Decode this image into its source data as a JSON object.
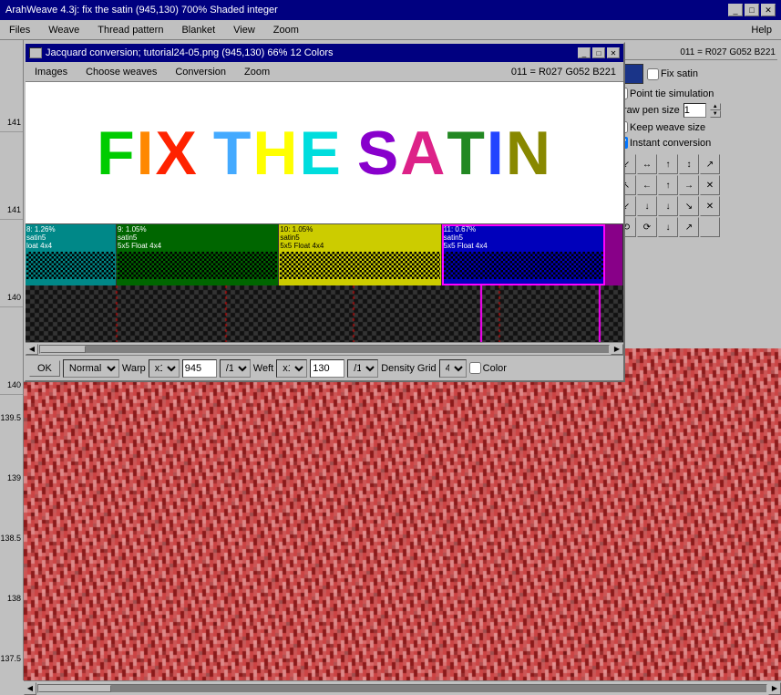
{
  "titleBar": {
    "title": "ArahWeave 4.3j: fix the satin (945,130) 700% Shaded integer",
    "controls": [
      "minimize",
      "maximize",
      "close"
    ]
  },
  "menuBar": {
    "items": [
      "Files",
      "Weave",
      "Thread pattern",
      "Blanket",
      "View",
      "Zoom",
      "Help"
    ]
  },
  "subWindow": {
    "title": "Jacquard conversion; tutorial24-05.png (945,130) 66% 12 Colors",
    "menu": {
      "left": [
        "Images",
        "Choose weaves",
        "Conversion",
        "Zoom"
      ],
      "right": "011 = R027 G052 B221"
    },
    "rightPanel": {
      "fixSatin": "Fix satin",
      "pointTie": "Point tie simulation",
      "drawPenSize": "Draw pen size",
      "penSizeValue": "1",
      "keepWeaveSize": "Keep weave size",
      "instantConversion": "Instant conversion"
    },
    "weaveStrips": [
      {
        "id": "8",
        "percent": "8: 1.26%",
        "weave": "satin5",
        "float": "loat 4x4",
        "color": "cyan"
      },
      {
        "id": "9",
        "percent": "9: 1.05%",
        "weave": "satin5",
        "float": "5x5 Float 4x4",
        "color": "green"
      },
      {
        "id": "10",
        "percent": "10: 1.05%",
        "weave": "satin5",
        "float": "5x5 Float 4x4",
        "color": "yellow"
      },
      {
        "id": "11",
        "percent": "11: 0.67%",
        "weave": "satin5",
        "float": "5x5 Float 4x4",
        "color": "blue"
      }
    ],
    "toolbar": {
      "ok": "OK",
      "mode": "Normal",
      "warp": "Warp",
      "warpMultiplier": "x1",
      "warpValue": "945",
      "warpDivider": "/1",
      "weft": "Weft",
      "weftMultiplier": "x1",
      "weftValue": "130",
      "weftDivider": "/1",
      "density": "Density",
      "grid": "Grid",
      "gridValue": "4",
      "color": "Color"
    }
  },
  "rulerLabels": [
    "141",
    "141",
    "140",
    "140"
  ],
  "sideRulerLabels": [
    "139.5",
    "139",
    "138.5",
    "138",
    "137.5"
  ],
  "arrowButtons": {
    "row1": [
      "↙",
      "↔",
      "↑",
      "↕",
      "↗"
    ],
    "row2": [
      "↖",
      "←",
      "↑",
      "→",
      "✕"
    ],
    "row3": [
      "↙",
      "↓",
      "↓",
      "↘",
      "✕"
    ],
    "row4": [
      "⟲",
      "⟳",
      "↓",
      "↗",
      ""
    ]
  },
  "letters": [
    {
      "char": "F",
      "color": "#00cc00"
    },
    {
      "char": "I",
      "color": "#ff8800"
    },
    {
      "char": "X",
      "color": "#ff2200"
    },
    {
      "char": " ",
      "color": "#000"
    },
    {
      "char": "T",
      "color": "#44aaff"
    },
    {
      "char": "H",
      "color": "#ffff00"
    },
    {
      "char": "E",
      "color": "#00dddd"
    },
    {
      "char": " ",
      "color": "#000"
    },
    {
      "char": "S",
      "color": "#8800cc"
    },
    {
      "char": "A",
      "color": "#dd2288"
    },
    {
      "char": "T",
      "color": "#228822"
    },
    {
      "char": "I",
      "color": "#2244ff"
    },
    {
      "char": "N",
      "color": "#888800"
    }
  ]
}
